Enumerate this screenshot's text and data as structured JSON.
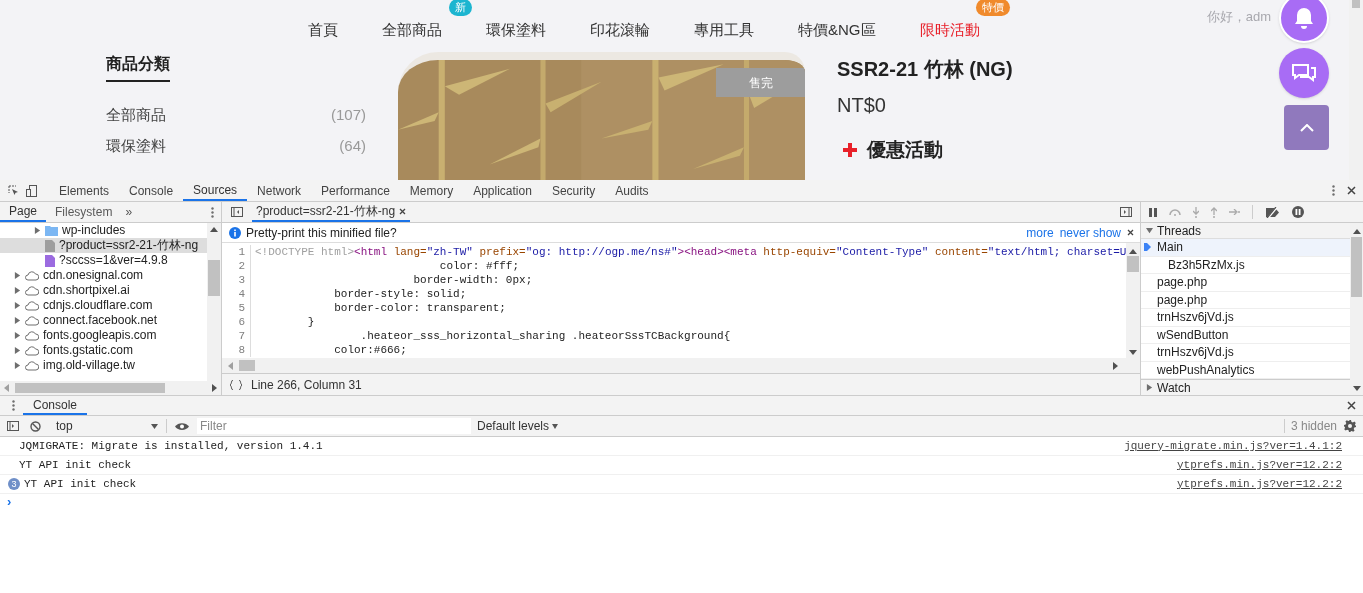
{
  "site": {
    "nav": [
      {
        "label": "首頁",
        "highlight": false
      },
      {
        "label": "全部商品",
        "badge": {
          "text": "新",
          "color": "#1cb5d0"
        },
        "highlight": false
      },
      {
        "label": "環保塗料",
        "highlight": false
      },
      {
        "label": "印花滾輪",
        "highlight": false
      },
      {
        "label": "專用工具",
        "highlight": false
      },
      {
        "label": "特價&NG區",
        "highlight": false
      },
      {
        "label": "限時活動",
        "badge": {
          "text": "特價",
          "color": "#f08a2c"
        },
        "highlight": true
      }
    ],
    "greeting": "你好，adm",
    "sidebar": {
      "title": "商品分類",
      "categories": [
        {
          "name": "全部商品",
          "count": "(107)"
        },
        {
          "name": "環保塗料",
          "count": "(64)"
        }
      ]
    },
    "product": {
      "sold_out": "售完",
      "title": "SSR2-21 竹林 (NG)",
      "price": "NT$0",
      "promo": "優惠活動"
    }
  },
  "devtools": {
    "tabs": [
      {
        "label": "Elements",
        "selected": false
      },
      {
        "label": "Console",
        "selected": false
      },
      {
        "label": "Sources",
        "selected": true
      },
      {
        "label": "Network",
        "selected": false
      },
      {
        "label": "Performance",
        "selected": false
      },
      {
        "label": "Memory",
        "selected": false
      },
      {
        "label": "Application",
        "selected": false
      },
      {
        "label": "Security",
        "selected": false
      },
      {
        "label": "Audits",
        "selected": false
      }
    ],
    "navigator": {
      "tabs": [
        {
          "label": "Page",
          "selected": true
        },
        {
          "label": "Filesystem",
          "selected": false
        }
      ],
      "more": "»",
      "scrolled_children": [
        {
          "kind": "folder",
          "label": "wp-includes",
          "selected": false
        },
        {
          "kind": "file",
          "label": "?product=ssr2-21-竹林-ng",
          "selected": true
        },
        {
          "kind": "script",
          "label": "?sccss=1&ver=4.9.8",
          "selected": false
        }
      ],
      "items": [
        {
          "kind": "domain",
          "label": "cdn.onesignal.com",
          "selected": false
        },
        {
          "kind": "domain",
          "label": "cdn.shortpixel.ai",
          "selected": false
        },
        {
          "kind": "domain",
          "label": "cdnjs.cloudflare.com",
          "selected": false
        },
        {
          "kind": "domain",
          "label": "connect.facebook.net",
          "selected": false
        },
        {
          "kind": "domain",
          "label": "fonts.googleapis.com",
          "selected": false
        },
        {
          "kind": "domain",
          "label": "fonts.gstatic.com",
          "selected": false
        },
        {
          "kind": "domain",
          "label": "img.old-village.tw",
          "selected": false
        }
      ]
    },
    "editor": {
      "tab": {
        "label": "?product=ssr2-21-竹林-ng",
        "selected": true
      },
      "infobar": {
        "text": "Pretty-print this minified file?",
        "links": [
          "more",
          "never show"
        ]
      },
      "lines": [
        {
          "number": "1",
          "tokens": [
            {
              "kind": "doctype",
              "text": "<!DOCTYPE html>"
            },
            {
              "kind": "tag",
              "text": "<html "
            },
            {
              "kind": "attr",
              "text": "lang="
            },
            {
              "kind": "value",
              "text": "\"zh-TW\""
            },
            {
              "kind": "attr",
              "text": " prefix="
            },
            {
              "kind": "value",
              "text": "\"og: http://ogp.me/ns#\""
            },
            {
              "kind": "tag",
              "text": ">"
            },
            {
              "kind": "tag",
              "text": "<head>"
            },
            {
              "kind": "tag",
              "text": "<meta "
            },
            {
              "kind": "attr",
              "text": "http-equiv="
            },
            {
              "kind": "value",
              "text": "\"Content-Type\""
            },
            {
              "kind": "attr",
              "text": " content="
            },
            {
              "kind": "value",
              "text": "\"text/html; charset=U"
            }
          ]
        },
        {
          "number": "2",
          "tokens": [
            {
              "kind": "plain",
              "text": "                            color: #fff;"
            }
          ]
        },
        {
          "number": "3",
          "tokens": [
            {
              "kind": "plain",
              "text": "                        border-width: 0px;"
            }
          ]
        },
        {
          "number": "4",
          "tokens": [
            {
              "kind": "plain",
              "text": "            border-style: solid;"
            }
          ]
        },
        {
          "number": "5",
          "tokens": [
            {
              "kind": "plain",
              "text": "            border-color: transparent;"
            }
          ]
        },
        {
          "number": "6",
          "tokens": [
            {
              "kind": "plain",
              "text": "        }"
            }
          ]
        },
        {
          "number": "7",
          "tokens": [
            {
              "kind": "plain",
              "text": "                .heateor_sss_horizontal_sharing .heateorSssTCBackground{"
            }
          ]
        },
        {
          "number": "8",
          "tokens": [
            {
              "kind": "plain",
              "text": "            color:#666;"
            }
          ]
        }
      ],
      "status": "Line 266, Column 31"
    },
    "debugger": {
      "threads": {
        "title": "Threads",
        "expanded": true,
        "items": [
          {
            "label": "Main",
            "selected": true,
            "children": [
              {
                "label": "Bz3h5RzMx.js"
              }
            ]
          },
          {
            "label": "page.php",
            "selected": false
          },
          {
            "label": "page.php",
            "selected": false
          },
          {
            "label": "trnHszv6jVd.js",
            "selected": false
          },
          {
            "label": "wSendButton",
            "selected": false
          },
          {
            "label": "trnHszv6jVd.js",
            "selected": false
          },
          {
            "label": "webPushAnalytics",
            "selected": false
          }
        ]
      },
      "watch": {
        "title": "Watch",
        "expanded": false
      }
    },
    "console": {
      "tab": {
        "label": "Console",
        "selected": true
      },
      "context": "top",
      "filter_placeholder": "Filter",
      "levels": "Default levels",
      "hidden": "3 hidden",
      "messages": [
        {
          "text": "JQMIGRATE: Migrate is installed, version 1.4.1",
          "source": "jquery-migrate.min.js?ver=1.4.1:2"
        },
        {
          "text": "YT API init check",
          "source": "ytprefs.min.js?ver=12.2:2"
        },
        {
          "text": "YT API init check",
          "source": "ytprefs.min.js?ver=12.2:2",
          "count": "3"
        }
      ],
      "prompt": "›"
    }
  }
}
